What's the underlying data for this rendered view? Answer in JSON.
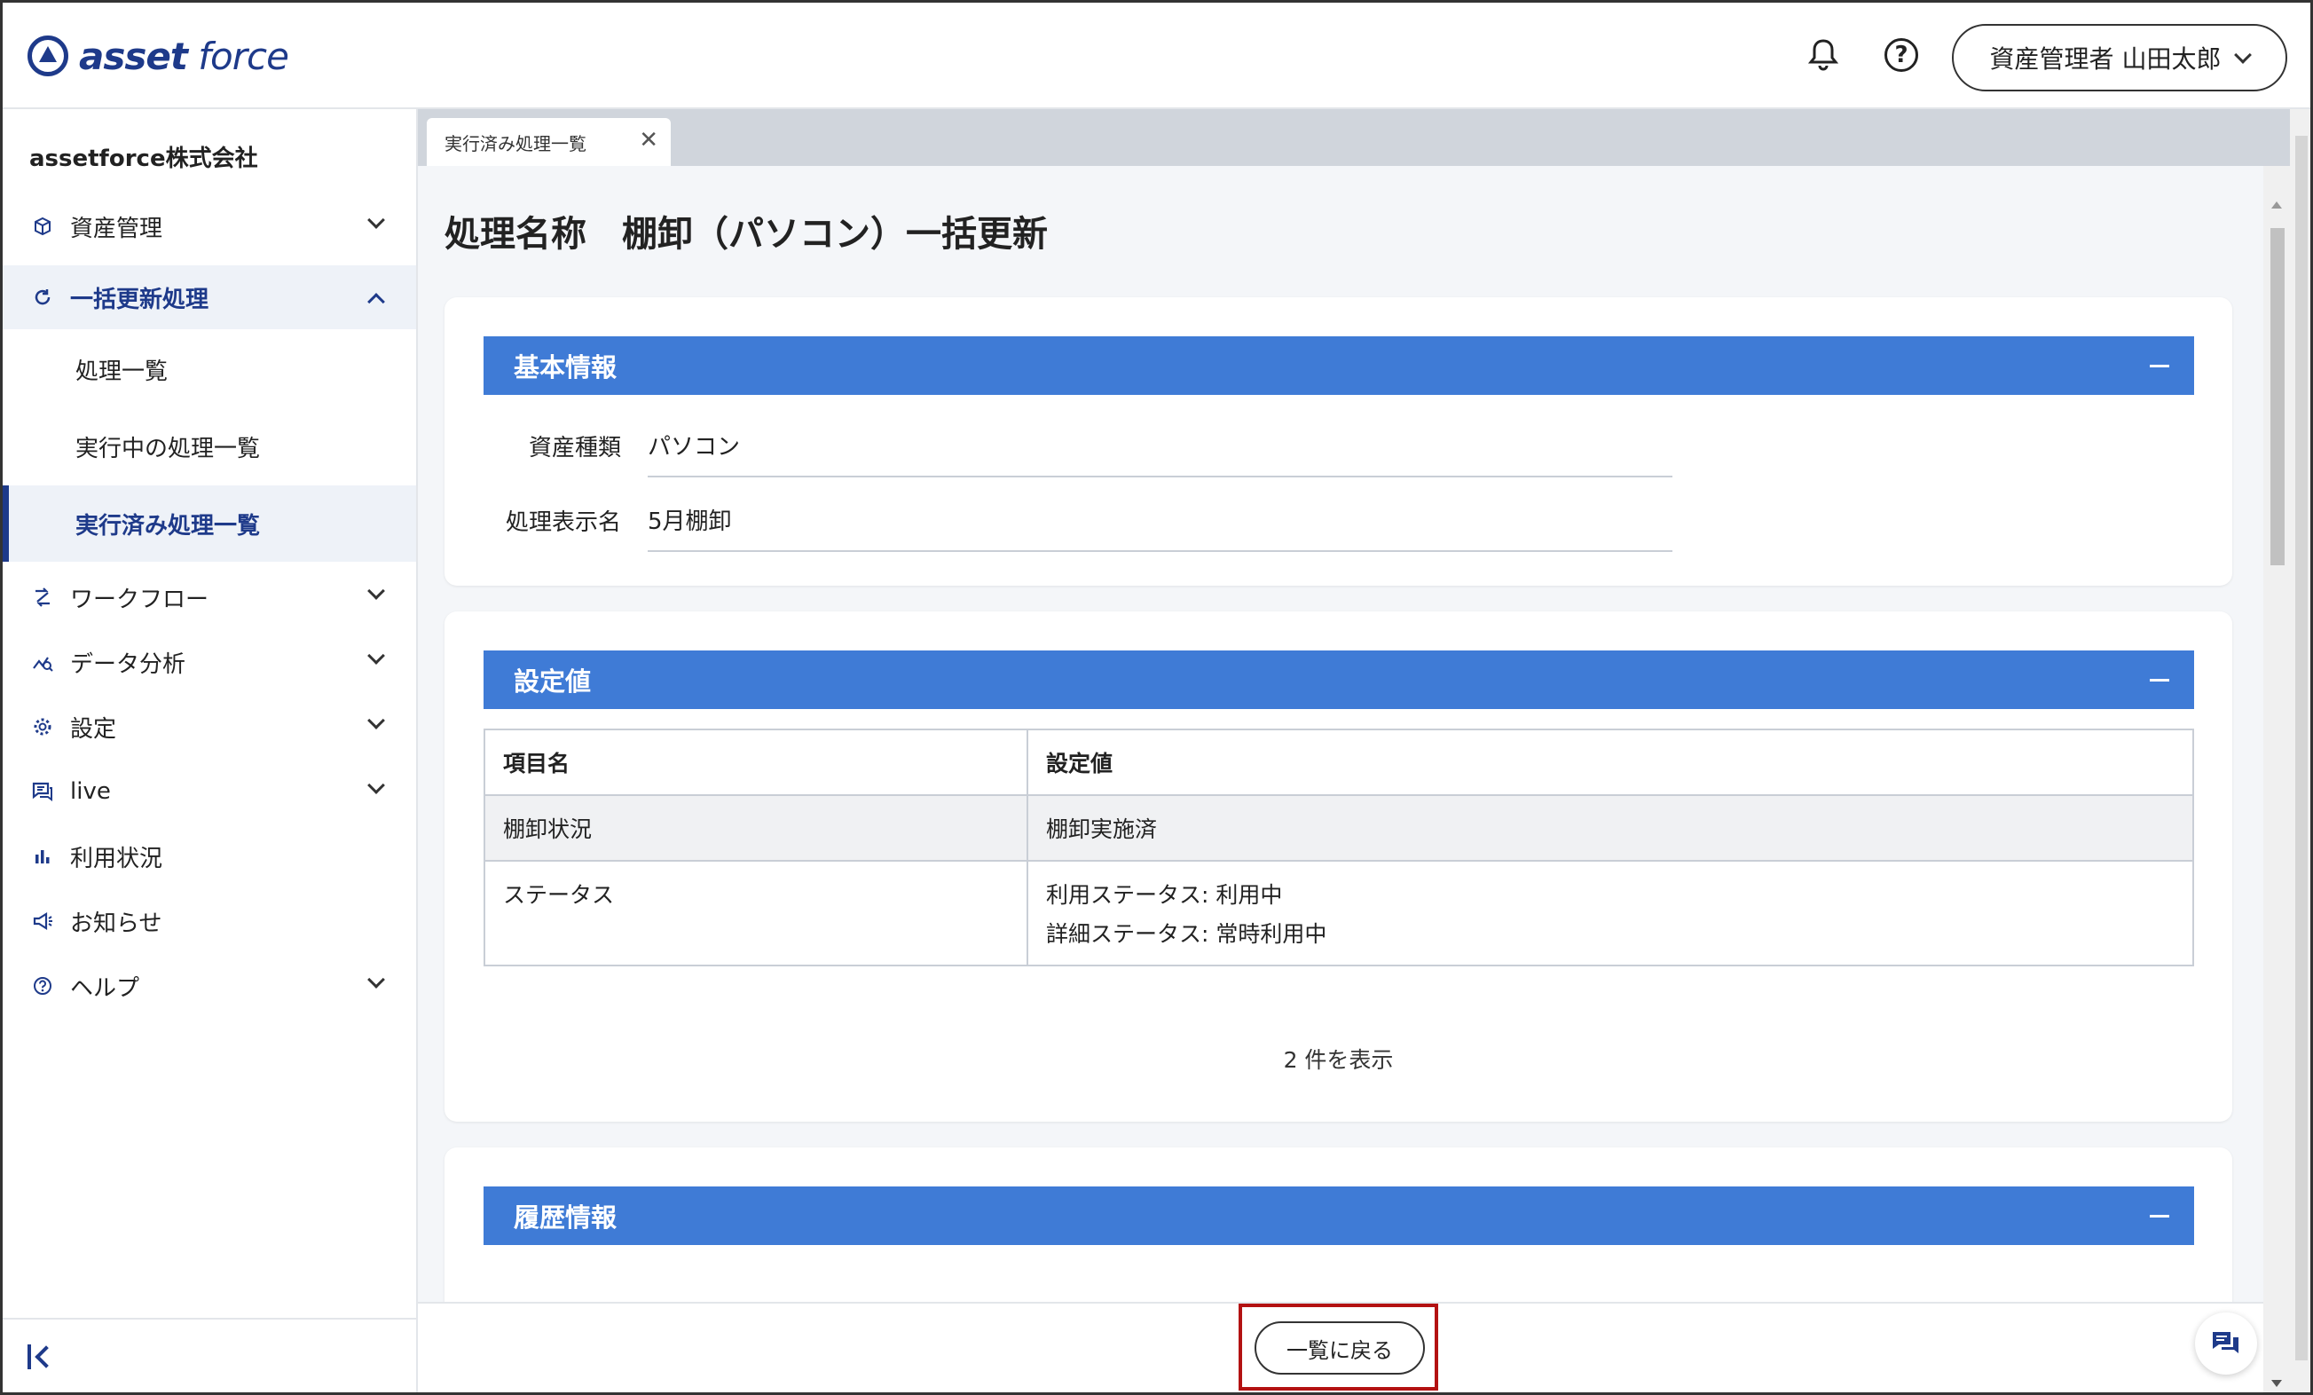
{
  "header": {
    "logo": {
      "bold": "asset",
      "light": " force"
    },
    "user_label": "資産管理者 山田太郎"
  },
  "sidebar": {
    "company": "assetforce株式会社",
    "items": [
      {
        "label": "資産管理",
        "icon": "cube-icon"
      },
      {
        "label": "一括更新処理",
        "icon": "refresh-icon"
      },
      {
        "label": "ワークフロー",
        "icon": "workflow-icon"
      },
      {
        "label": "データ分析",
        "icon": "analytics-icon"
      },
      {
        "label": "設定",
        "icon": "gear-icon"
      },
      {
        "label": "live",
        "icon": "chat-icon"
      },
      {
        "label": "利用状況",
        "icon": "bar-chart-icon"
      },
      {
        "label": "お知らせ",
        "icon": "megaphone-icon"
      },
      {
        "label": "ヘルプ",
        "icon": "help-icon"
      }
    ],
    "subitems": [
      {
        "label": "処理一覧"
      },
      {
        "label": "実行中の処理一覧"
      },
      {
        "label": "実行済み処理一覧"
      }
    ]
  },
  "tabs": [
    {
      "label": "実行済み処理一覧"
    }
  ],
  "page_title": "処理名称　棚卸（パソコン）一括更新",
  "basic_info": {
    "title": "基本情報",
    "fields": [
      {
        "label": "資産種類",
        "value": "パソコン"
      },
      {
        "label": "処理表示名",
        "value": "5月棚卸"
      }
    ]
  },
  "settings": {
    "title": "設定値",
    "columns": [
      "項目名",
      "設定値"
    ],
    "rows": [
      {
        "name": "棚卸状況",
        "value_line1": "棚卸実施済",
        "value_line2": ""
      },
      {
        "name": "ステータス",
        "value_line1": "利用ステータス: 利用中",
        "value_line2": "詳細ステータス: 常時利用中"
      }
    ],
    "count_label": "2 件を表示"
  },
  "history": {
    "title": "履歴情報"
  },
  "footer": {
    "back_label": "一覧に戻る"
  },
  "colors": {
    "accent": "#3f7bd6",
    "brand": "#1e3a8a",
    "highlight": "#b31212"
  }
}
